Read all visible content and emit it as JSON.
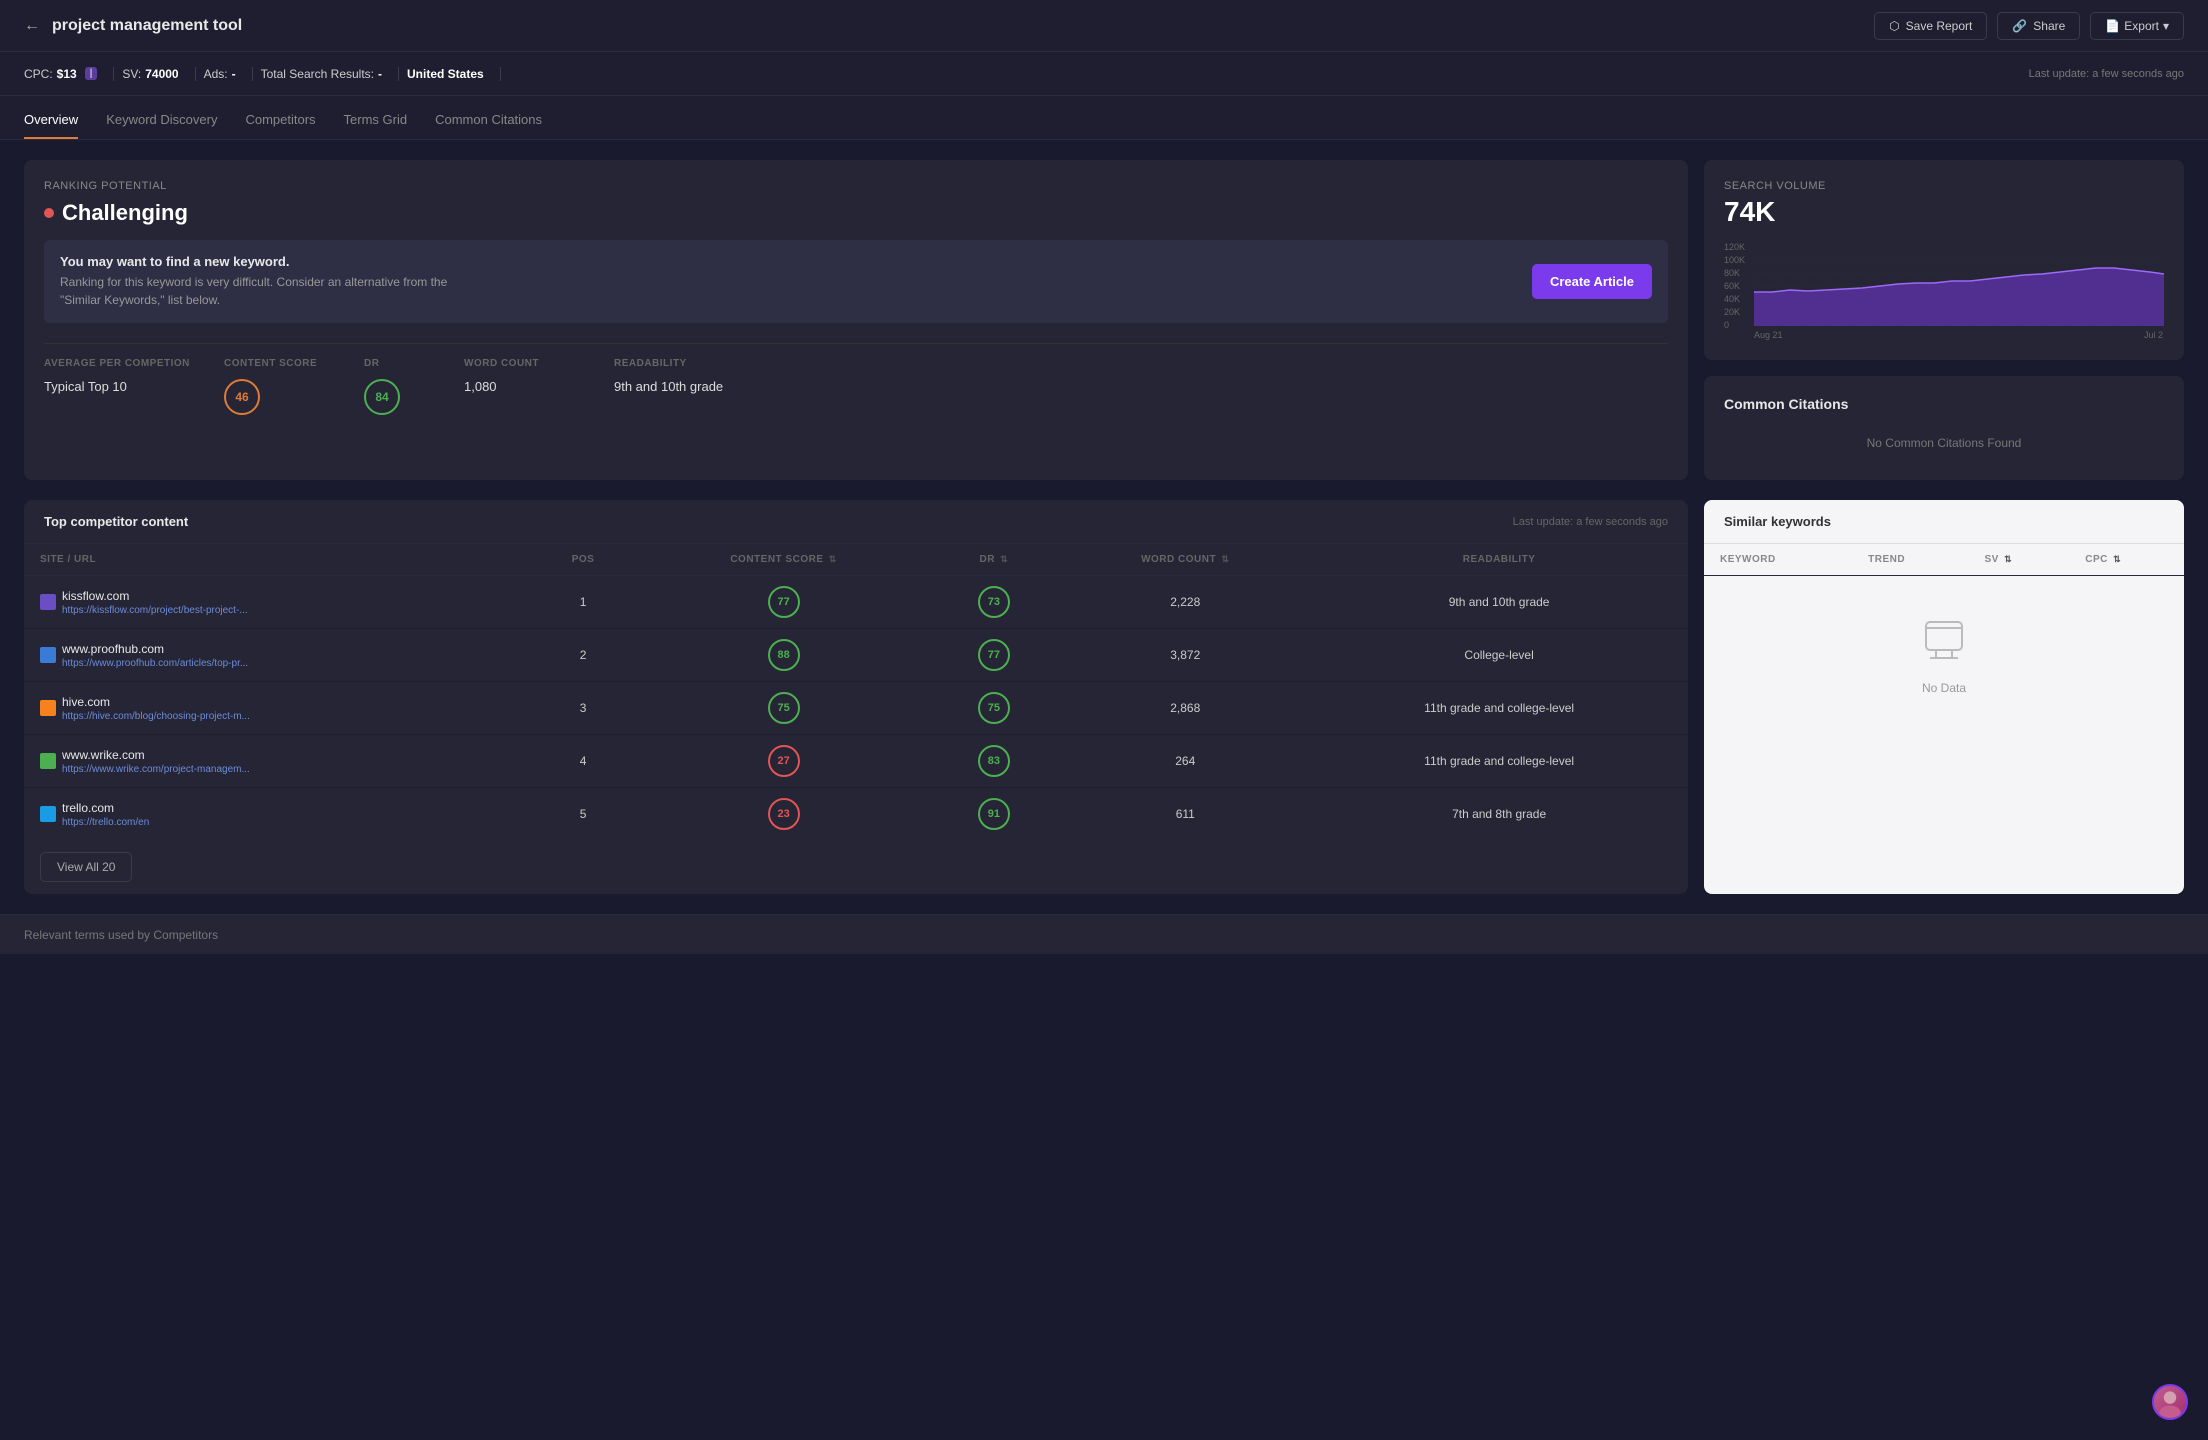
{
  "header": {
    "back_label": "←",
    "title": "project management tool",
    "save_report": "Save Report",
    "share": "Share",
    "export": "Export"
  },
  "meta": {
    "cpc_label": "CPC:",
    "cpc_value": "$13",
    "sv_label": "SV:",
    "sv_value": "74000",
    "ads_label": "Ads:",
    "ads_value": "-",
    "total_label": "Total Search Results:",
    "total_value": "-",
    "location": "United States",
    "last_update": "Last update: a few seconds ago"
  },
  "tabs": [
    {
      "label": "Overview",
      "active": true
    },
    {
      "label": "Keyword Discovery",
      "active": false
    },
    {
      "label": "Competitors",
      "active": false
    },
    {
      "label": "Terms Grid",
      "active": false
    },
    {
      "label": "Common Citations",
      "active": false
    }
  ],
  "ranking": {
    "section_label": "Ranking Potential",
    "value": "Challenging",
    "alert_title": "You may want to find a new keyword.",
    "alert_body": "Ranking for this keyword is very difficult. Consider an alternative from the \"Similar Keywords,\" list below.",
    "create_btn": "Create Article"
  },
  "metrics": {
    "col1_header": "AVERAGE PER COMPETION",
    "col2_header": "CONTENT SCORE",
    "col3_header": "DR",
    "col4_header": "WORD COUNT",
    "col5_header": "READABILITY",
    "row1_label": "Typical Top 10",
    "row1_content_score": "46",
    "row1_dr": "84",
    "row1_word_count": "1,080",
    "row1_readability": "9th and 10th grade"
  },
  "search_volume": {
    "label": "Search Volume",
    "value": "74K",
    "chart_labels": [
      "Aug 21",
      "Jul 2"
    ],
    "chart_y_labels": [
      "120K",
      "100K",
      "80K",
      "60K",
      "40K",
      "20K",
      "0"
    ],
    "chart_data": [
      55,
      55,
      58,
      56,
      57,
      58,
      60,
      62,
      64,
      65,
      65,
      68,
      68,
      70,
      72,
      74,
      76,
      78,
      80,
      82,
      84,
      82,
      80
    ]
  },
  "common_citations": {
    "title": "Common Citations",
    "no_data": "No Common Citations Found"
  },
  "competitor": {
    "title": "Top competitor content",
    "last_update": "Last update: a few seconds ago",
    "columns": [
      "SITE / URL",
      "POS",
      "CONTENT SCORE",
      "DR",
      "WORD COUNT",
      "READABILITY"
    ],
    "rows": [
      {
        "site": "kissflow.com",
        "url": "https://kissflow.com/project/best-project-...",
        "pos": "1",
        "content_score": "77",
        "content_color": "green",
        "dr": "73",
        "dr_color": "green",
        "word_count": "2,228",
        "readability": "9th and 10th grade",
        "icon_color": "#6b4dc4"
      },
      {
        "site": "www.proofhub.com",
        "url": "https://www.proofhub.com/articles/top-pr...",
        "pos": "2",
        "content_score": "88",
        "content_color": "green",
        "dr": "77",
        "dr_color": "green",
        "word_count": "3,872",
        "readability": "College-level",
        "icon_color": "#3a7bd5"
      },
      {
        "site": "hive.com",
        "url": "https://hive.com/blog/choosing-project-m...",
        "pos": "3",
        "content_score": "75",
        "content_color": "green",
        "dr": "75",
        "dr_color": "green",
        "word_count": "2,868",
        "readability": "11th grade and college-level",
        "icon_color": "#f5821f"
      },
      {
        "site": "www.wrike.com",
        "url": "https://www.wrike.com/project-managem...",
        "pos": "4",
        "content_score": "27",
        "content_color": "red",
        "dr": "83",
        "dr_color": "green",
        "word_count": "264",
        "readability": "11th grade and college-level",
        "icon_color": "#4caf50"
      },
      {
        "site": "trello.com",
        "url": "https://trello.com/en",
        "pos": "5",
        "content_score": "23",
        "content_color": "red",
        "dr": "91",
        "dr_color": "green",
        "word_count": "611",
        "readability": "7th and 8th grade",
        "icon_color": "#1a9be5"
      }
    ],
    "view_all": "View All 20"
  },
  "similar_keywords": {
    "title": "Similar keywords",
    "columns": [
      "KEYWORD",
      "TREND",
      "SV",
      "CPC"
    ],
    "no_data": "No Data"
  },
  "relevant_terms": {
    "label": "Relevant terms used by Competitors"
  }
}
